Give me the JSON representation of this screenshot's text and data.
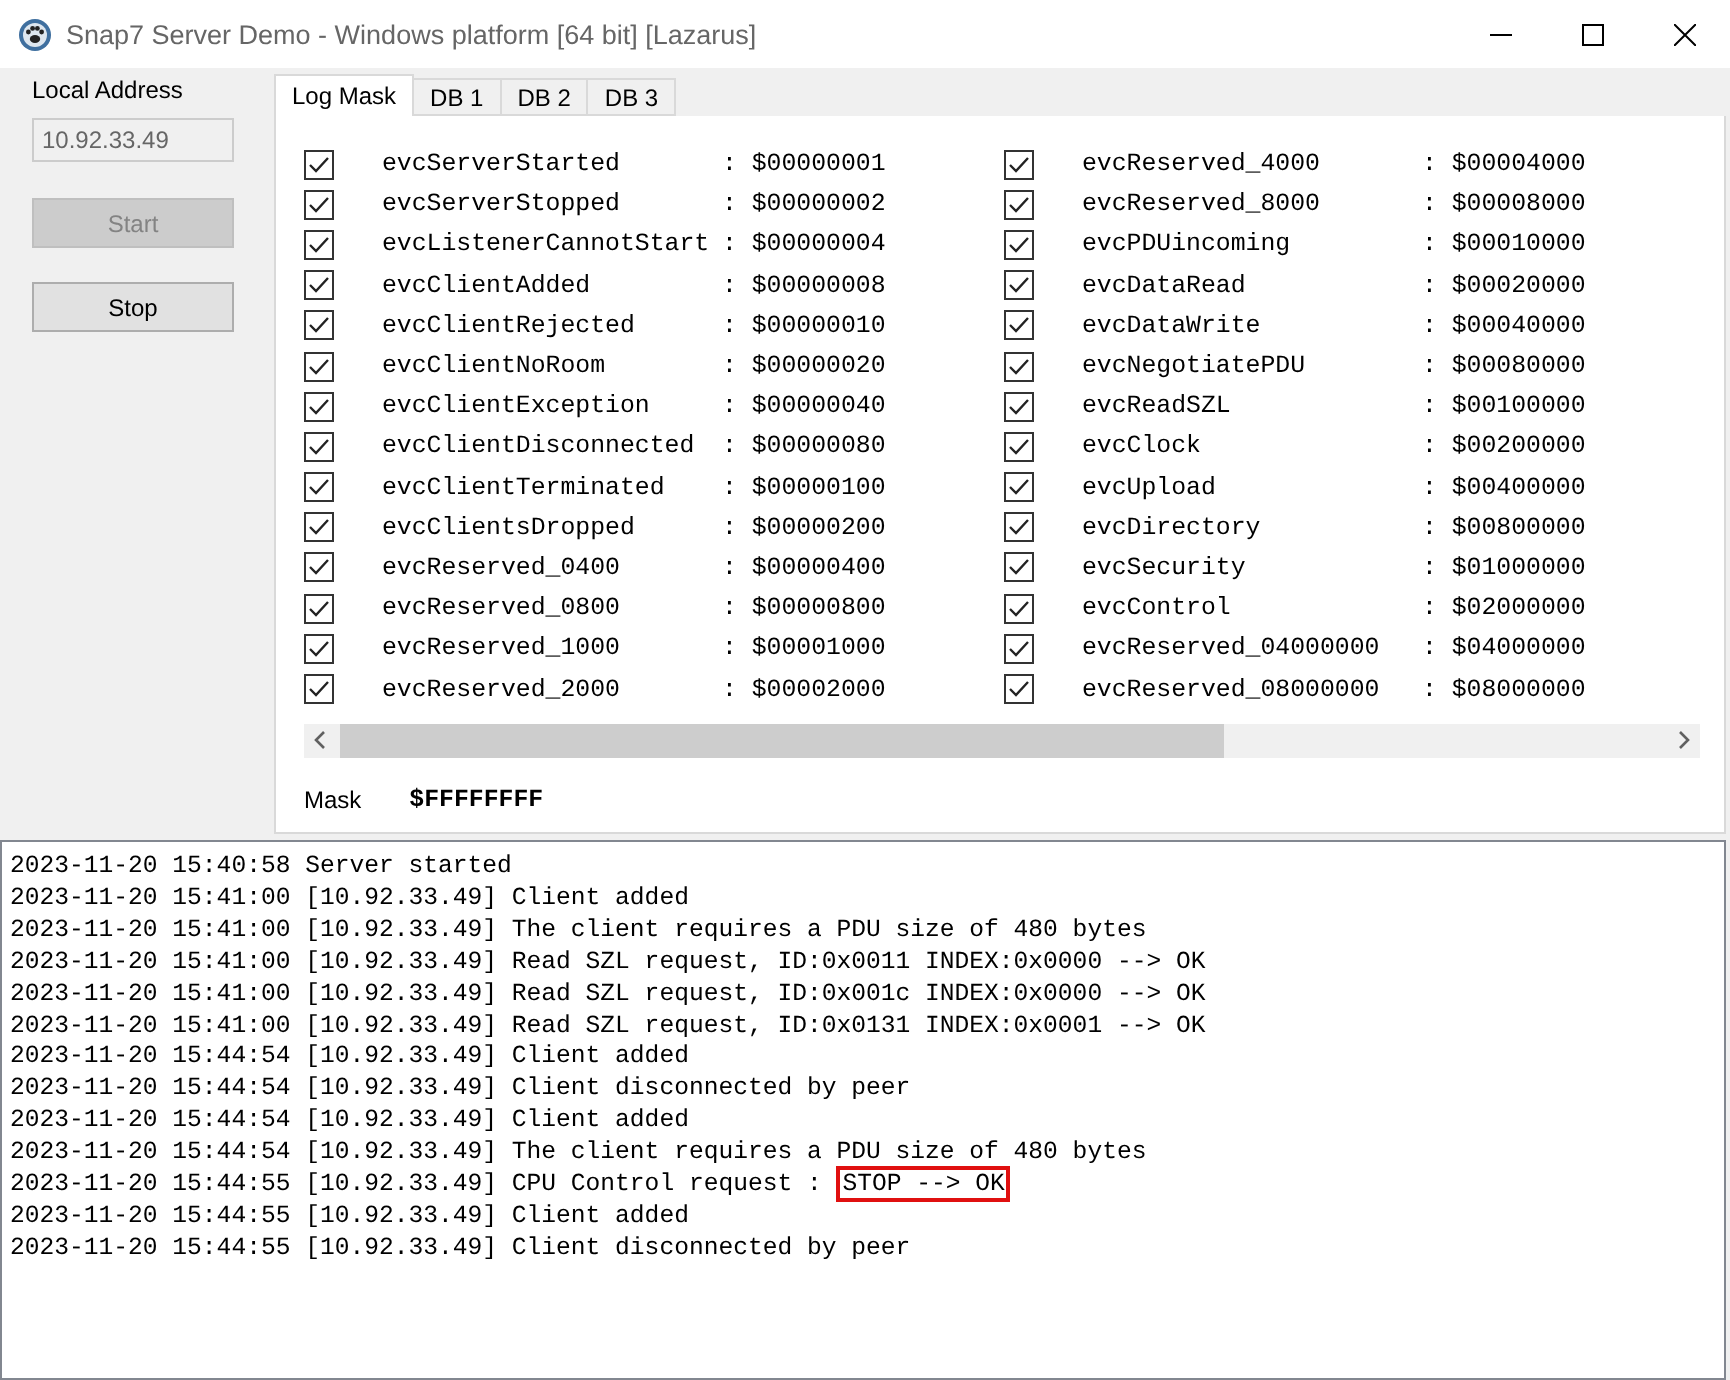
{
  "window": {
    "title": "Snap7 Server Demo - Windows platform [64 bit] [Lazarus]"
  },
  "sidebar": {
    "address_label": "Local Address",
    "address_value": "10.92.33.49",
    "buttons": [
      {
        "label": "Start",
        "disabled": true
      },
      {
        "label": "Stop",
        "disabled": false
      }
    ]
  },
  "tabs": [
    {
      "label": "Log Mask",
      "selected": true
    },
    {
      "label": "DB 1",
      "selected": false
    },
    {
      "label": "DB 2",
      "selected": false
    },
    {
      "label": "DB 3",
      "selected": false
    }
  ],
  "mask_columns": [
    [
      {
        "name": "evcServerStarted",
        "value": ": $00000001",
        "checked": true
      },
      {
        "name": "evcServerStopped",
        "value": ": $00000002",
        "checked": true
      },
      {
        "name": "evcListenerCannotStart",
        "value": ": $00000004",
        "checked": true
      },
      {
        "name": "evcClientAdded",
        "value": ": $00000008",
        "checked": true
      },
      {
        "name": "evcClientRejected",
        "value": ": $00000010",
        "checked": true
      },
      {
        "name": "evcClientNoRoom",
        "value": ": $00000020",
        "checked": true
      },
      {
        "name": "evcClientException",
        "value": ": $00000040",
        "checked": true
      },
      {
        "name": "evcClientDisconnected",
        "value": ": $00000080",
        "checked": true
      },
      {
        "name": "evcClientTerminated",
        "value": ": $00000100",
        "checked": true
      },
      {
        "name": "evcClientsDropped",
        "value": ": $00000200",
        "checked": true
      },
      {
        "name": "evcReserved_0400",
        "value": ": $00000400",
        "checked": true
      },
      {
        "name": "evcReserved_0800",
        "value": ": $00000800",
        "checked": true
      },
      {
        "name": "evcReserved_1000",
        "value": ": $00001000",
        "checked": true
      },
      {
        "name": "evcReserved_2000",
        "value": ": $00002000",
        "checked": true
      }
    ],
    [
      {
        "name": "evcReserved_4000",
        "value": ": $00004000",
        "checked": true
      },
      {
        "name": "evcReserved_8000",
        "value": ": $00008000",
        "checked": true
      },
      {
        "name": "evcPDUincoming",
        "value": ": $00010000",
        "checked": true
      },
      {
        "name": "evcDataRead",
        "value": ": $00020000",
        "checked": true
      },
      {
        "name": "evcDataWrite",
        "value": ": $00040000",
        "checked": true
      },
      {
        "name": "evcNegotiatePDU",
        "value": ": $00080000",
        "checked": true
      },
      {
        "name": "evcReadSZL",
        "value": ": $00100000",
        "checked": true
      },
      {
        "name": "evcClock",
        "value": ": $00200000",
        "checked": true
      },
      {
        "name": "evcUpload",
        "value": ": $00400000",
        "checked": true
      },
      {
        "name": "evcDirectory",
        "value": ": $00800000",
        "checked": true
      },
      {
        "name": "evcSecurity",
        "value": ": $01000000",
        "checked": true
      },
      {
        "name": "evcControl",
        "value": ": $02000000",
        "checked": true
      },
      {
        "name": "evcReserved_04000000",
        "value": ": $04000000",
        "checked": true
      },
      {
        "name": "evcReserved_08000000",
        "value": ": $08000000",
        "checked": true
      }
    ]
  ],
  "mask": {
    "label": "Mask",
    "value": "$FFFFFFFF"
  },
  "log": [
    {
      "text": "2023-11-20 15:40:58 Server started"
    },
    {
      "text": "2023-11-20 15:41:00 [10.92.33.49] Client added"
    },
    {
      "text": "2023-11-20 15:41:00 [10.92.33.49] The client requires a PDU size of 480 bytes"
    },
    {
      "text": "2023-11-20 15:41:00 [10.92.33.49] Read SZL request, ID:0x0011 INDEX:0x0000 --> OK"
    },
    {
      "text": "2023-11-20 15:41:00 [10.92.33.49] Read SZL request, ID:0x001c INDEX:0x0000 --> OK"
    },
    {
      "text": "2023-11-20 15:41:00 [10.92.33.49] Read SZL request, ID:0x0131 INDEX:0x0001 --> OK"
    },
    {
      "text": "2023-11-20 15:44:54 [10.92.33.49] Client added"
    },
    {
      "text": "2023-11-20 15:44:54 [10.92.33.49] Client disconnected by peer"
    },
    {
      "text": "2023-11-20 15:44:54 [10.92.33.49] Client added"
    },
    {
      "text": "2023-11-20 15:44:54 [10.92.33.49] The client requires a PDU size of 480 bytes"
    },
    {
      "text": "2023-11-20 15:44:55 [10.92.33.49] CPU Control request :",
      "highlight": "STOP --> OK"
    },
    {
      "text": "2023-11-20 15:44:55 [10.92.33.49] Client added"
    },
    {
      "text": "2023-11-20 15:44:55 [10.92.33.49] Client disconnected by peer"
    }
  ]
}
